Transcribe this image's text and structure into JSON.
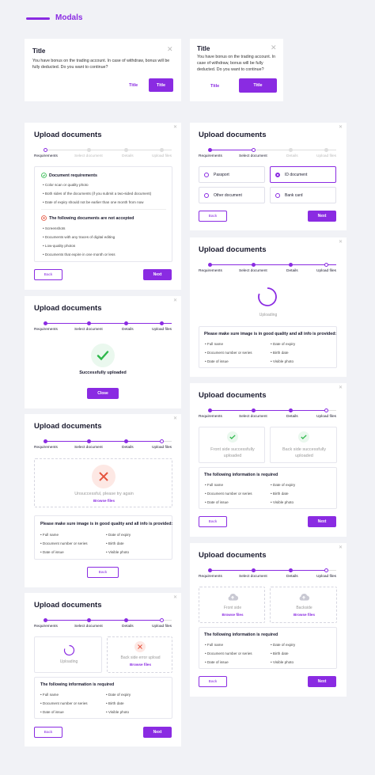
{
  "section_title": "Modals",
  "modal_small_left": {
    "title": "Title",
    "text": "You have bonus on the trading account. In case of withdraw, bonus will be fully deducted. Do you want to continue?",
    "link": "Title",
    "button": "Title"
  },
  "modal_small_right": {
    "title": "Title",
    "text": "You have bonus on the trading account. In case of withdraw, bonus will be fully deducted. Do you want to continue?",
    "link": "Title",
    "button": "Title"
  },
  "upload_title": "Upload documents",
  "steps": [
    "Requirements",
    "Select document",
    "Details",
    "Upload files"
  ],
  "requirements": {
    "accepted_title": "Document requirements",
    "accepted": [
      "Color scan or quality photo",
      "Both sides of the documents (if you submit a two-sided document)",
      "Date of expiry should not be earlier than one month from now"
    ],
    "rejected_title": "The following documents are not accepted",
    "rejected": [
      "Screenshots",
      "Documents with any traces of digital editing",
      "Low-quality photos",
      "Documents that expire in one month or less"
    ]
  },
  "doc_types": [
    "Passport",
    "ID document",
    "Other document",
    "Bank card"
  ],
  "buttons": {
    "back": "Back",
    "next": "Next",
    "close": "Close"
  },
  "success_text": "Successfully uploaded",
  "uploading_text": "Uploading",
  "fail": {
    "text": "Unsuccessful, please try again",
    "link": "Browse files"
  },
  "quality_title": "Please make sure image is in good quality and all info is provided:",
  "info_title": "The following information is required",
  "info_left": [
    "Full name",
    "Document number or series",
    "Date of issue"
  ],
  "info_right": [
    "Date of expiry",
    "Birth date",
    "Visible photo"
  ],
  "front_success": "Front side successfully uploaded",
  "back_success": "Back side successfully uploaded",
  "back_error": "Back side error upload",
  "browse": "Browse files",
  "front_side": "Front side",
  "backside": "Backside",
  "colors": {
    "accent": "#8A2BE2",
    "success": "#2DB84B",
    "error": "#E5533D",
    "background": "#F1F2F6"
  },
  "icons": [
    "close-icon",
    "check-circle-icon",
    "error-circle-icon",
    "checkmark-icon",
    "cross-icon",
    "cloud-upload-icon",
    "spinner-icon"
  ]
}
